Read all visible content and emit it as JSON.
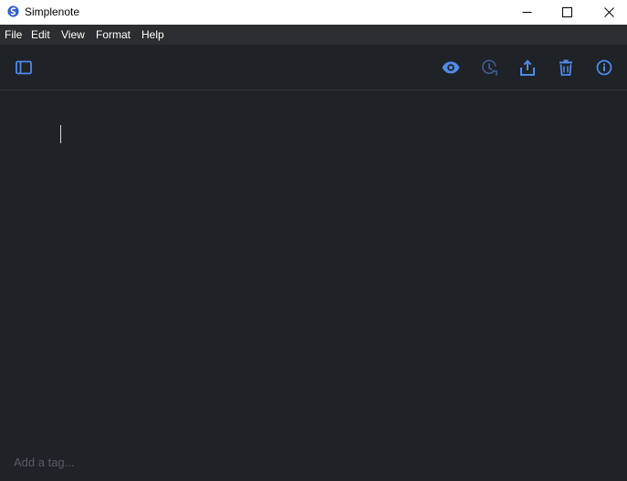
{
  "window": {
    "title": "Simplenote"
  },
  "menu": {
    "items": [
      {
        "label": "File"
      },
      {
        "label": "Edit"
      },
      {
        "label": "View"
      },
      {
        "label": "Format"
      },
      {
        "label": "Help"
      }
    ]
  },
  "toolbar": {
    "icons": [
      "sidebar-toggle-icon",
      "eye-icon",
      "history-icon",
      "share-icon",
      "trash-icon",
      "info-icon"
    ],
    "accent_color": "#4f8ae8",
    "disabled_color": "#3d5a8a"
  },
  "editor": {
    "content": ""
  },
  "tags": {
    "placeholder": "Add a tag..."
  },
  "colors": {
    "background": "#1f2227",
    "menubar": "#2b2d30"
  }
}
